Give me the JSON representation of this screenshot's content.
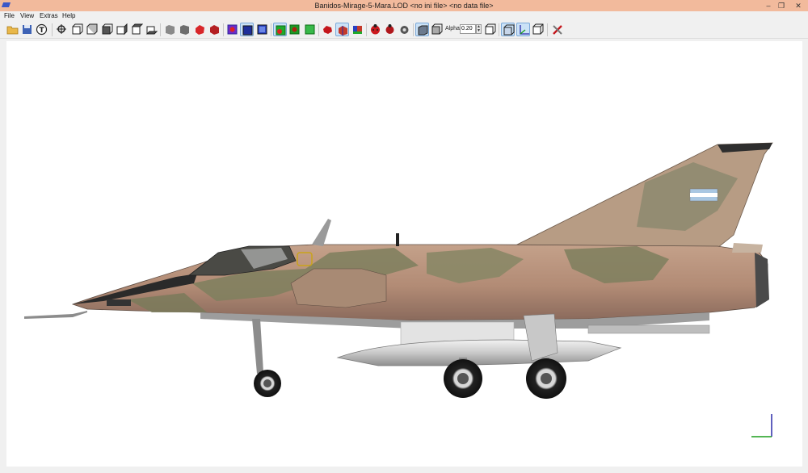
{
  "window": {
    "title": "Banidos-Mirage-5-Mara.LOD  <no ini file>  <no data file>",
    "minimize": "–",
    "maximize": "❐",
    "close": "✕"
  },
  "menu": [
    "File",
    "View",
    "Extras",
    "Help"
  ],
  "toolbar": {
    "icons": [
      "open-folder-icon",
      "save-disk-icon",
      "text-t-icon",
      "zoom-fit-icon",
      "view-front-icon",
      "view-back-icon",
      "view-left-icon",
      "view-right-icon",
      "view-top-icon",
      "view-bottom-icon",
      "shade-gray-1-icon",
      "shade-gray-2-icon",
      "shade-red-1-icon",
      "shade-red-2-icon",
      "select-all-icon",
      "select-box-icon",
      "select-frame-icon",
      "layer-green-1-icon",
      "layer-green-2-icon",
      "layer-green-3-icon",
      "bug-red-icon",
      "cube-colored-1-icon",
      "cube-colored-2-icon",
      "ladybug-1-icon",
      "ladybug-2-icon",
      "gear-ladybug-icon",
      "solid-cube-icon",
      "wire-cube-icon",
      "bounding-box-icon",
      "transparent-cube-icon",
      "axes-icon",
      "cube-outline-icon",
      "tools-icon"
    ],
    "alpha_label": "Alpha:",
    "alpha_value": "0.20"
  },
  "viewport": {
    "aircraft_model": "Mirage 5 Mara",
    "axes_colors": {
      "x": "#1b9e1b",
      "y": "#2a2aa8"
    }
  }
}
